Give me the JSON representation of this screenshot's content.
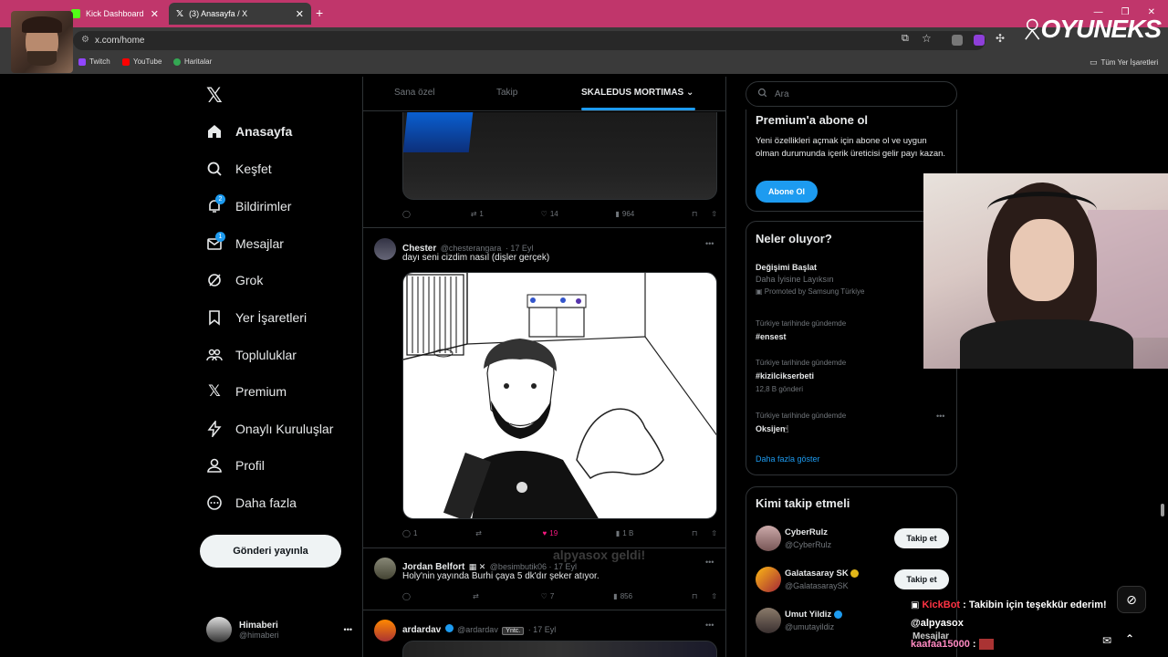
{
  "browser": {
    "tabs": [
      {
        "label": "Kick Dashboard"
      },
      {
        "label": "(3) Anasayfa / X"
      }
    ],
    "url": "x.com/home",
    "bookmarks": [
      {
        "label": "Twitch",
        "color": "#9146ff"
      },
      {
        "label": "YouTube",
        "color": "#ff0000"
      },
      {
        "label": "Haritalar",
        "color": "#34a853"
      }
    ],
    "all_bookmarks": "Tüm Yer İşaretleri"
  },
  "overlay": {
    "logo_text": "OYUNEKS"
  },
  "nav": {
    "items": [
      {
        "label": "Anasayfa",
        "icon": "home-icon",
        "active": true
      },
      {
        "label": "Keşfet",
        "icon": "search-icon"
      },
      {
        "label": "Bildirimler",
        "icon": "bell-icon",
        "badge": "2"
      },
      {
        "label": "Mesajlar",
        "icon": "mail-icon",
        "badge": "1"
      },
      {
        "label": "Grok",
        "icon": "grok-icon"
      },
      {
        "label": "Yer İşaretleri",
        "icon": "bookmark-icon"
      },
      {
        "label": "Topluluklar",
        "icon": "communities-icon"
      },
      {
        "label": "Premium",
        "icon": "x-icon"
      },
      {
        "label": "Onaylı Kuruluşlar",
        "icon": "lightning-icon"
      },
      {
        "label": "Profil",
        "icon": "profile-icon"
      },
      {
        "label": "Daha fazla",
        "icon": "more-circle-icon"
      }
    ],
    "post_button": "Gönderi yayınla",
    "account": {
      "name": "Himaberi",
      "handle": "@himaberi",
      "more": "•••"
    }
  },
  "feed": {
    "tabs": [
      "Sana özel",
      "Takip",
      "SKALEDUS MORTIMAS"
    ],
    "tweets": [
      {
        "replies": "",
        "retweets": "1",
        "likes": "14",
        "views": "964"
      },
      {
        "name": "Chester",
        "handle": "@chesterangara",
        "date": "· 17 Eyl",
        "text": "dayı seni cizdim nasıl (dişler gerçek)",
        "replies": "1",
        "retweets": "",
        "likes": "19",
        "views": "1 B"
      },
      {
        "name": "Jordan Belfort",
        "handle": "@besimbutik06 · 17 Eyl",
        "text": "Holy'nin yayında Burhi çaya 5 dk'dır şeker atıyor.",
        "replies": "",
        "retweets": "",
        "likes": "7",
        "views": "856"
      },
      {
        "name": "ardardav",
        "handle": "@ardardav",
        "badge": "Yntc.",
        "date": "· 17 Eyl"
      }
    ],
    "overlay_text": "alpyasox geldi!"
  },
  "right": {
    "search_placeholder": "Ara",
    "premium": {
      "title": "Premium'a abone ol",
      "body": "Yeni özellikleri açmak için abone ol ve uygun olman durumunda içerik üreticisi gelir payı kazan.",
      "button": "Abone Ol"
    },
    "trends": {
      "title": "Neler oluyor?",
      "items": [
        {
          "title": "Değişimi Başlat",
          "sub": "Daha İyisine Layıksın",
          "promo": "Promoted by Samsung Türkiye"
        },
        {
          "context": "Türkiye tarihinde gündemde",
          "title": "#ensest"
        },
        {
          "context": "Türkiye tarihinde gündemde",
          "title": "#kizilcikserbeti",
          "count": "12,8 B gönderi"
        },
        {
          "context": "Türkiye tarihinde gündemde",
          "title": "Oksijen"
        }
      ],
      "show_more": "Daha fazla göster"
    },
    "follow": {
      "title": "Kimi takip etmeli",
      "button": "Takip et",
      "users": [
        {
          "name": "CyberRulz",
          "handle": "@CyberRulz"
        },
        {
          "name": "Galatasaray SK",
          "handle": "@GalatasaraySK"
        },
        {
          "name": "Umut Yildiz",
          "handle": "@umutayildiz"
        }
      ]
    }
  },
  "chat": {
    "line1_user": "KickBot",
    "line1_text": ": Takibin için teşekkür ederim!",
    "line2": "@alpyasox",
    "line3": "Mesajlar",
    "line4_user": "kaafaa15000",
    "line4_sep": ":"
  },
  "colors": {
    "accent": "#1d9bf0",
    "tabbar": "#c0366b",
    "like": "#f91880",
    "kickbot": "#ff3344"
  }
}
